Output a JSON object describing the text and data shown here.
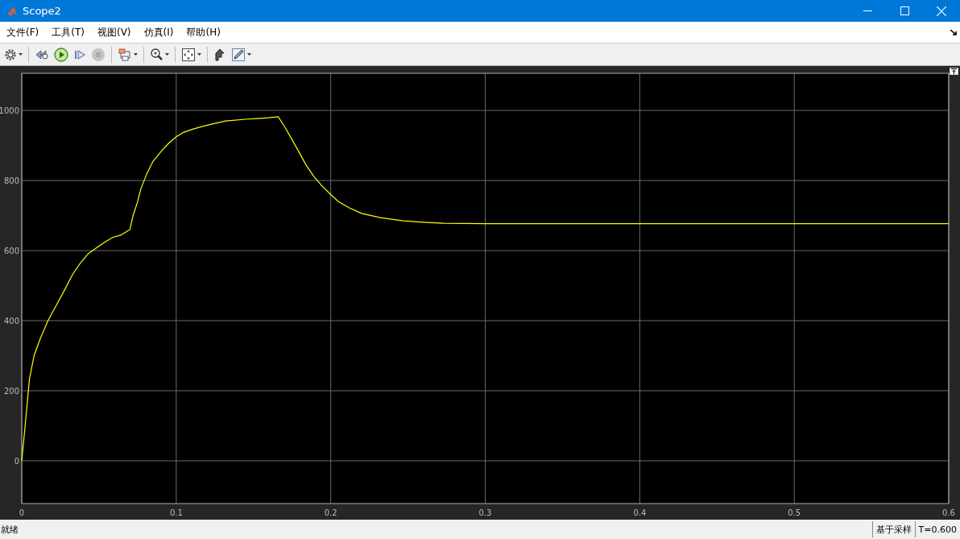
{
  "window": {
    "title": "Scope2"
  },
  "menu": [
    {
      "label": "文件(F)"
    },
    {
      "label": "工具(T)"
    },
    {
      "label": "视图(V)"
    },
    {
      "label": "仿真(I)"
    },
    {
      "label": "帮助(H)"
    }
  ],
  "toolbar": [
    {
      "kind": "settings",
      "dropdown": true
    },
    {
      "kind": "sep"
    },
    {
      "kind": "rewind",
      "dropdown": false
    },
    {
      "kind": "play",
      "dropdown": false
    },
    {
      "kind": "step",
      "dropdown": false
    },
    {
      "kind": "stop",
      "dropdown": false,
      "disabled": true
    },
    {
      "kind": "sep"
    },
    {
      "kind": "blocks",
      "dropdown": true
    },
    {
      "kind": "sep"
    },
    {
      "kind": "zoom",
      "dropdown": true
    },
    {
      "kind": "sep"
    },
    {
      "kind": "fit",
      "dropdown": true
    },
    {
      "kind": "sep"
    },
    {
      "kind": "style",
      "dropdown": false
    },
    {
      "kind": "pen",
      "dropdown": true
    }
  ],
  "plot": {
    "chart_data": {
      "type": "line",
      "x": [
        0,
        0.002,
        0.005,
        0.008,
        0.012,
        0.017,
        0.022,
        0.028,
        0.033,
        0.038,
        0.043,
        0.049,
        0.054,
        0.059,
        0.064,
        0.067,
        0.07,
        0.072,
        0.075,
        0.077,
        0.081,
        0.085,
        0.09,
        0.095,
        0.1,
        0.105,
        0.111,
        0.12,
        0.132,
        0.145,
        0.153,
        0.16,
        0.166,
        0.17,
        0.174,
        0.179,
        0.184,
        0.189,
        0.194,
        0.2,
        0.205,
        0.212,
        0.22,
        0.232,
        0.247,
        0.26,
        0.273,
        0.3,
        0.4,
        0.5,
        0.6
      ],
      "series": [
        {
          "color": "#ffff00",
          "values": [
            0,
            90,
            234,
            300,
            349,
            400,
            441,
            490,
            533,
            565,
            591,
            610,
            625,
            638,
            644,
            652,
            660,
            699,
            740,
            775,
            820,
            855,
            882,
            906,
            925,
            938,
            947,
            958,
            970,
            975,
            977,
            979,
            982,
            955,
            924,
            885,
            844,
            812,
            786,
            760,
            740,
            722,
            706,
            694,
            685,
            681,
            678,
            677,
            677,
            677,
            677
          ]
        }
      ],
      "xlim": [
        0,
        0.6
      ],
      "ylim": [
        -122,
        1106
      ],
      "xticks": [
        0,
        0.1,
        0.2,
        0.3,
        0.4,
        0.5,
        0.6
      ],
      "yticks": [
        0,
        200,
        400,
        600,
        800,
        1000
      ],
      "grid": true
    }
  },
  "status_bar": {
    "message": "就绪",
    "mode": "基于采样",
    "time": "T=0.600"
  }
}
